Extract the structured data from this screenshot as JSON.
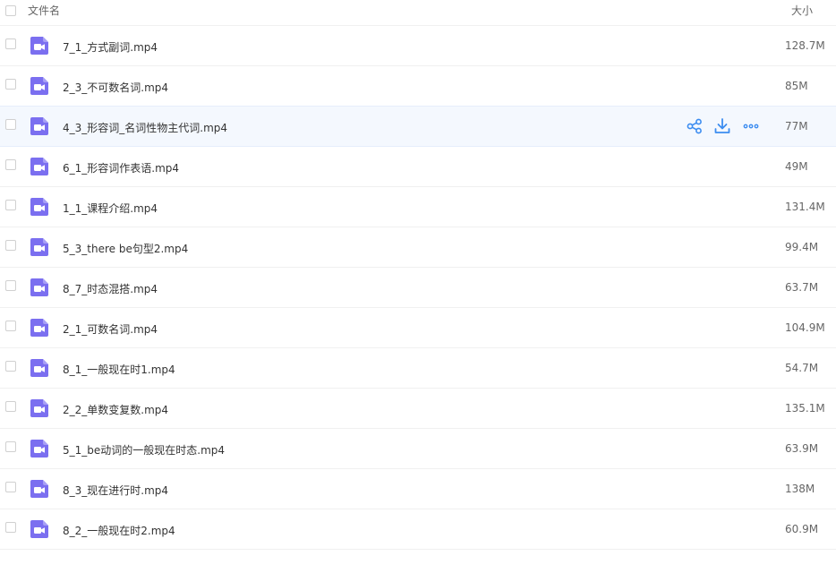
{
  "header": {
    "name_label": "文件名",
    "size_label": "大小"
  },
  "colors": {
    "icon_bg": "#7b6ff0",
    "action_blue": "#3b8cf0",
    "hover_row_bg": "#f4f8fe"
  },
  "hover_row_index": 2,
  "actions": [
    {
      "name": "share-icon"
    },
    {
      "name": "download-icon"
    },
    {
      "name": "more-icon"
    }
  ],
  "files": [
    {
      "name": "7_1_方式副词.mp4",
      "size": "128.7M",
      "icon": "video-file-icon"
    },
    {
      "name": "2_3_不可数名词.mp4",
      "size": "85M",
      "icon": "video-file-icon"
    },
    {
      "name": "4_3_形容词_名词性物主代词.mp4",
      "size": "77M",
      "icon": "video-file-icon"
    },
    {
      "name": "6_1_形容词作表语.mp4",
      "size": "49M",
      "icon": "video-file-icon"
    },
    {
      "name": "1_1_课程介绍.mp4",
      "size": "131.4M",
      "icon": "video-file-icon"
    },
    {
      "name": "5_3_there be句型2.mp4",
      "size": "99.4M",
      "icon": "video-file-icon"
    },
    {
      "name": "8_7_时态混搭.mp4",
      "size": "63.7M",
      "icon": "video-file-icon"
    },
    {
      "name": "2_1_可数名词.mp4",
      "size": "104.9M",
      "icon": "video-file-icon"
    },
    {
      "name": "8_1_一般现在时1.mp4",
      "size": "54.7M",
      "icon": "video-file-icon"
    },
    {
      "name": "2_2_单数变复数.mp4",
      "size": "135.1M",
      "icon": "video-file-icon"
    },
    {
      "name": "5_1_be动词的一般现在时态.mp4",
      "size": "63.9M",
      "icon": "video-file-icon"
    },
    {
      "name": "8_3_现在进行时.mp4",
      "size": "138M",
      "icon": "video-file-icon"
    },
    {
      "name": "8_2_一般现在时2.mp4",
      "size": "60.9M",
      "icon": "video-file-icon"
    }
  ]
}
